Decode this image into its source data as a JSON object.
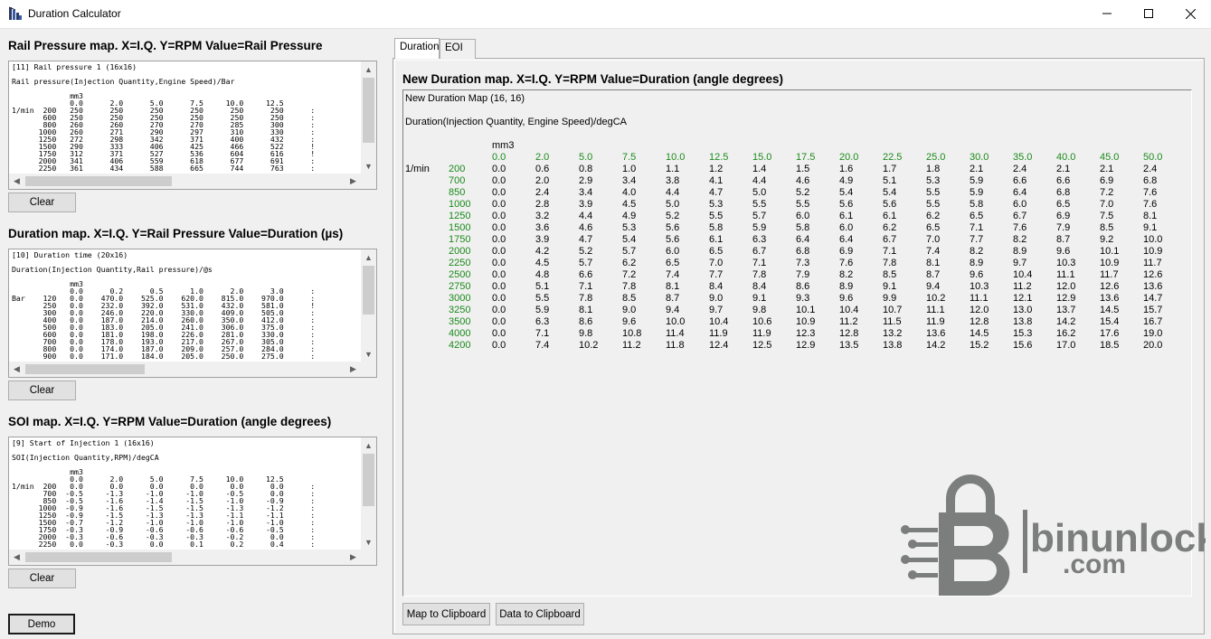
{
  "window": {
    "title": "Duration Calculator",
    "controls": [
      "minimize",
      "maximize",
      "close"
    ]
  },
  "left": {
    "rail": {
      "title": "Rail Pressure map. X=I.Q.  Y=RPM  Value=Rail Pressure",
      "lines": [
        "[11] Rail pressure 1 (16x16)",
        "",
        "Rail pressure(Injection Quantity,Engine Speed)/Bar",
        "",
        "             mm3",
        "             0.0      2.0      5.0      7.5     10.0     12.5",
        "1/min  200   250      250      250      250      250      250      :",
        "       600   250      250      250      250      250      250      :",
        "       800   260      260      270      270      285      300      :",
        "      1000   260      271      290      297      310      330      :",
        "      1250   272      298      342      371      400      432      :",
        "      1500   290      333      406      425      466      522      !",
        "      1750   312      371      527      536      604      616      !",
        "      2000   341      406      559      618      677      691      :",
        "      2250   361      434      588      665      744      763      :"
      ],
      "clear_label": "Clear"
    },
    "duration": {
      "title": "Duration map. X=I.Q.  Y=Rail Pressure  Value=Duration (µs)",
      "lines": [
        "[10] Duration time (20x16)",
        "",
        "Duration(Injection Quantity,Rail pressure)/@s",
        "",
        "             mm3",
        "             0.0      0.2      0.5      1.0      2.0      3.0      :",
        "Bar    120   0.0    470.0    525.0    620.0    815.0    970.0      :",
        "       250   0.0    232.0    392.0    531.0    432.0    581.0      !",
        "       300   0.0    246.0    220.0    330.0    409.0    505.0      :",
        "       400   0.0    187.0    214.0    260.0    350.0    412.0      :",
        "       500   0.0    183.0    205.0    241.0    306.0    375.0      :",
        "       600   0.0    181.0    198.0    226.0    281.0    330.0      :",
        "       700   0.0    178.0    193.0    217.0    267.0    305.0      :",
        "       800   0.0    174.0    187.0    209.0    257.0    284.0      :",
        "       900   0.0    171.0    184.0    205.0    250.0    275.0      :"
      ],
      "clear_label": "Clear"
    },
    "soi": {
      "title": "SOI map. X=I.Q.  Y=RPM  Value=Duration (angle degrees)",
      "lines": [
        "[9] Start of Injection 1 (16x16)",
        "",
        "SOI(Injection Quantity,RPM)/degCA",
        "",
        "             mm3",
        "             0.0      2.0      5.0      7.5     10.0     12.5",
        "1/min  200   0.0      0.0      0.0      0.0      0.0      0.0      :",
        "       700  -0.5     -1.3     -1.0     -1.0     -0.5      0.0      :",
        "       850  -0.5     -1.6     -1.4     -1.5     -1.0     -0.9      :",
        "      1000  -0.9     -1.6     -1.5     -1.5     -1.3     -1.2      :",
        "      1250  -0.9     -1.5     -1.3     -1.3     -1.1     -1.1      :",
        "      1500  -0.7     -1.2     -1.0     -1.0     -1.0     -1.0      :",
        "      1750  -0.3     -0.9     -0.6     -0.6     -0.6     -0.5      :",
        "      2000  -0.3     -0.6     -0.3     -0.3     -0.2      0.0      :",
        "      2250   0.0     -0.3      0.0      0.1      0.2      0.4      :"
      ],
      "clear_label": "Clear"
    },
    "demo_label": "Demo"
  },
  "right": {
    "tabs": [
      {
        "label": "Duration",
        "active": true
      },
      {
        "label": "EOI",
        "active": false
      }
    ],
    "map_title": "New Duration map. X=I.Q.  Y=RPM  Value=Duration (angle degrees)",
    "grid": {
      "header": "New Duration Map (16, 16)",
      "subheader": "Duration(Injection Quantity, Engine Speed)/degCA",
      "x_unit": "mm3",
      "y_unit": "1/min",
      "x": [
        "0.0",
        "2.0",
        "5.0",
        "7.5",
        "10.0",
        "12.5",
        "15.0",
        "17.5",
        "20.0",
        "22.5",
        "25.0",
        "30.0",
        "35.0",
        "40.0",
        "45.0",
        "50.0"
      ],
      "rows": [
        {
          "rpm": "200",
          "values": [
            "0.0",
            "0.6",
            "0.8",
            "1.0",
            "1.1",
            "1.2",
            "1.4",
            "1.5",
            "1.6",
            "1.7",
            "1.8",
            "2.1",
            "2.4",
            "2.1",
            "2.1",
            "2.4"
          ]
        },
        {
          "rpm": "700",
          "values": [
            "0.0",
            "2.0",
            "2.9",
            "3.4",
            "3.8",
            "4.1",
            "4.4",
            "4.6",
            "4.9",
            "5.1",
            "5.3",
            "5.9",
            "6.6",
            "6.6",
            "6.9",
            "6.8"
          ]
        },
        {
          "rpm": "850",
          "values": [
            "0.0",
            "2.4",
            "3.4",
            "4.0",
            "4.4",
            "4.7",
            "5.0",
            "5.2",
            "5.4",
            "5.4",
            "5.5",
            "5.9",
            "6.4",
            "6.8",
            "7.2",
            "7.6"
          ]
        },
        {
          "rpm": "1000",
          "values": [
            "0.0",
            "2.8",
            "3.9",
            "4.5",
            "5.0",
            "5.3",
            "5.5",
            "5.5",
            "5.6",
            "5.6",
            "5.5",
            "5.8",
            "6.0",
            "6.5",
            "7.0",
            "7.6"
          ]
        },
        {
          "rpm": "1250",
          "values": [
            "0.0",
            "3.2",
            "4.4",
            "4.9",
            "5.2",
            "5.5",
            "5.7",
            "6.0",
            "6.1",
            "6.1",
            "6.2",
            "6.5",
            "6.7",
            "6.9",
            "7.5",
            "8.1"
          ]
        },
        {
          "rpm": "1500",
          "values": [
            "0.0",
            "3.6",
            "4.6",
            "5.3",
            "5.6",
            "5.8",
            "5.9",
            "5.8",
            "6.0",
            "6.2",
            "6.5",
            "7.1",
            "7.6",
            "7.9",
            "8.5",
            "9.1"
          ]
        },
        {
          "rpm": "1750",
          "values": [
            "0.0",
            "3.9",
            "4.7",
            "5.4",
            "5.6",
            "6.1",
            "6.3",
            "6.4",
            "6.4",
            "6.7",
            "7.0",
            "7.7",
            "8.2",
            "8.7",
            "9.2",
            "10.0"
          ]
        },
        {
          "rpm": "2000",
          "values": [
            "0.0",
            "4.2",
            "5.2",
            "5.7",
            "6.0",
            "6.5",
            "6.7",
            "6.8",
            "6.9",
            "7.1",
            "7.4",
            "8.2",
            "8.9",
            "9.6",
            "10.1",
            "10.9"
          ]
        },
        {
          "rpm": "2250",
          "values": [
            "0.0",
            "4.5",
            "5.7",
            "6.2",
            "6.5",
            "7.0",
            "7.1",
            "7.3",
            "7.6",
            "7.8",
            "8.1",
            "8.9",
            "9.7",
            "10.3",
            "10.9",
            "11.7"
          ]
        },
        {
          "rpm": "2500",
          "values": [
            "0.0",
            "4.8",
            "6.6",
            "7.2",
            "7.4",
            "7.7",
            "7.8",
            "7.9",
            "8.2",
            "8.5",
            "8.7",
            "9.6",
            "10.4",
            "11.1",
            "11.7",
            "12.6"
          ]
        },
        {
          "rpm": "2750",
          "values": [
            "0.0",
            "5.1",
            "7.1",
            "7.8",
            "8.1",
            "8.4",
            "8.4",
            "8.6",
            "8.9",
            "9.1",
            "9.4",
            "10.3",
            "11.2",
            "12.0",
            "12.6",
            "13.6"
          ]
        },
        {
          "rpm": "3000",
          "values": [
            "0.0",
            "5.5",
            "7.8",
            "8.5",
            "8.7",
            "9.0",
            "9.1",
            "9.3",
            "9.6",
            "9.9",
            "10.2",
            "11.1",
            "12.1",
            "12.9",
            "13.6",
            "14.7"
          ]
        },
        {
          "rpm": "3250",
          "values": [
            "0.0",
            "5.9",
            "8.1",
            "9.0",
            "9.4",
            "9.7",
            "9.8",
            "10.1",
            "10.4",
            "10.7",
            "11.1",
            "12.0",
            "13.0",
            "13.7",
            "14.5",
            "15.7"
          ]
        },
        {
          "rpm": "3500",
          "values": [
            "0.0",
            "6.3",
            "8.6",
            "9.6",
            "10.0",
            "10.4",
            "10.6",
            "10.9",
            "11.2",
            "11.5",
            "11.9",
            "12.8",
            "13.8",
            "14.2",
            "15.4",
            "16.7"
          ]
        },
        {
          "rpm": "4000",
          "values": [
            "0.0",
            "7.1",
            "9.8",
            "10.8",
            "11.4",
            "11.9",
            "11.9",
            "12.3",
            "12.8",
            "13.2",
            "13.6",
            "14.5",
            "15.3",
            "16.2",
            "17.6",
            "19.0"
          ]
        },
        {
          "rpm": "4200",
          "values": [
            "0.0",
            "7.4",
            "10.2",
            "11.2",
            "11.8",
            "12.4",
            "12.5",
            "12.9",
            "13.5",
            "13.8",
            "14.2",
            "15.2",
            "15.6",
            "17.0",
            "18.5",
            "20.0"
          ]
        }
      ]
    },
    "map_to_clipboard_label": "Map to Clipboard",
    "data_to_clipboard_label": "Data to Clipboard"
  },
  "watermark": {
    "brand": "binunlock",
    "tld": ".com"
  },
  "colors": {
    "axis_label_green": "#1a8a1a",
    "watermark_gray": "#6f7270"
  }
}
